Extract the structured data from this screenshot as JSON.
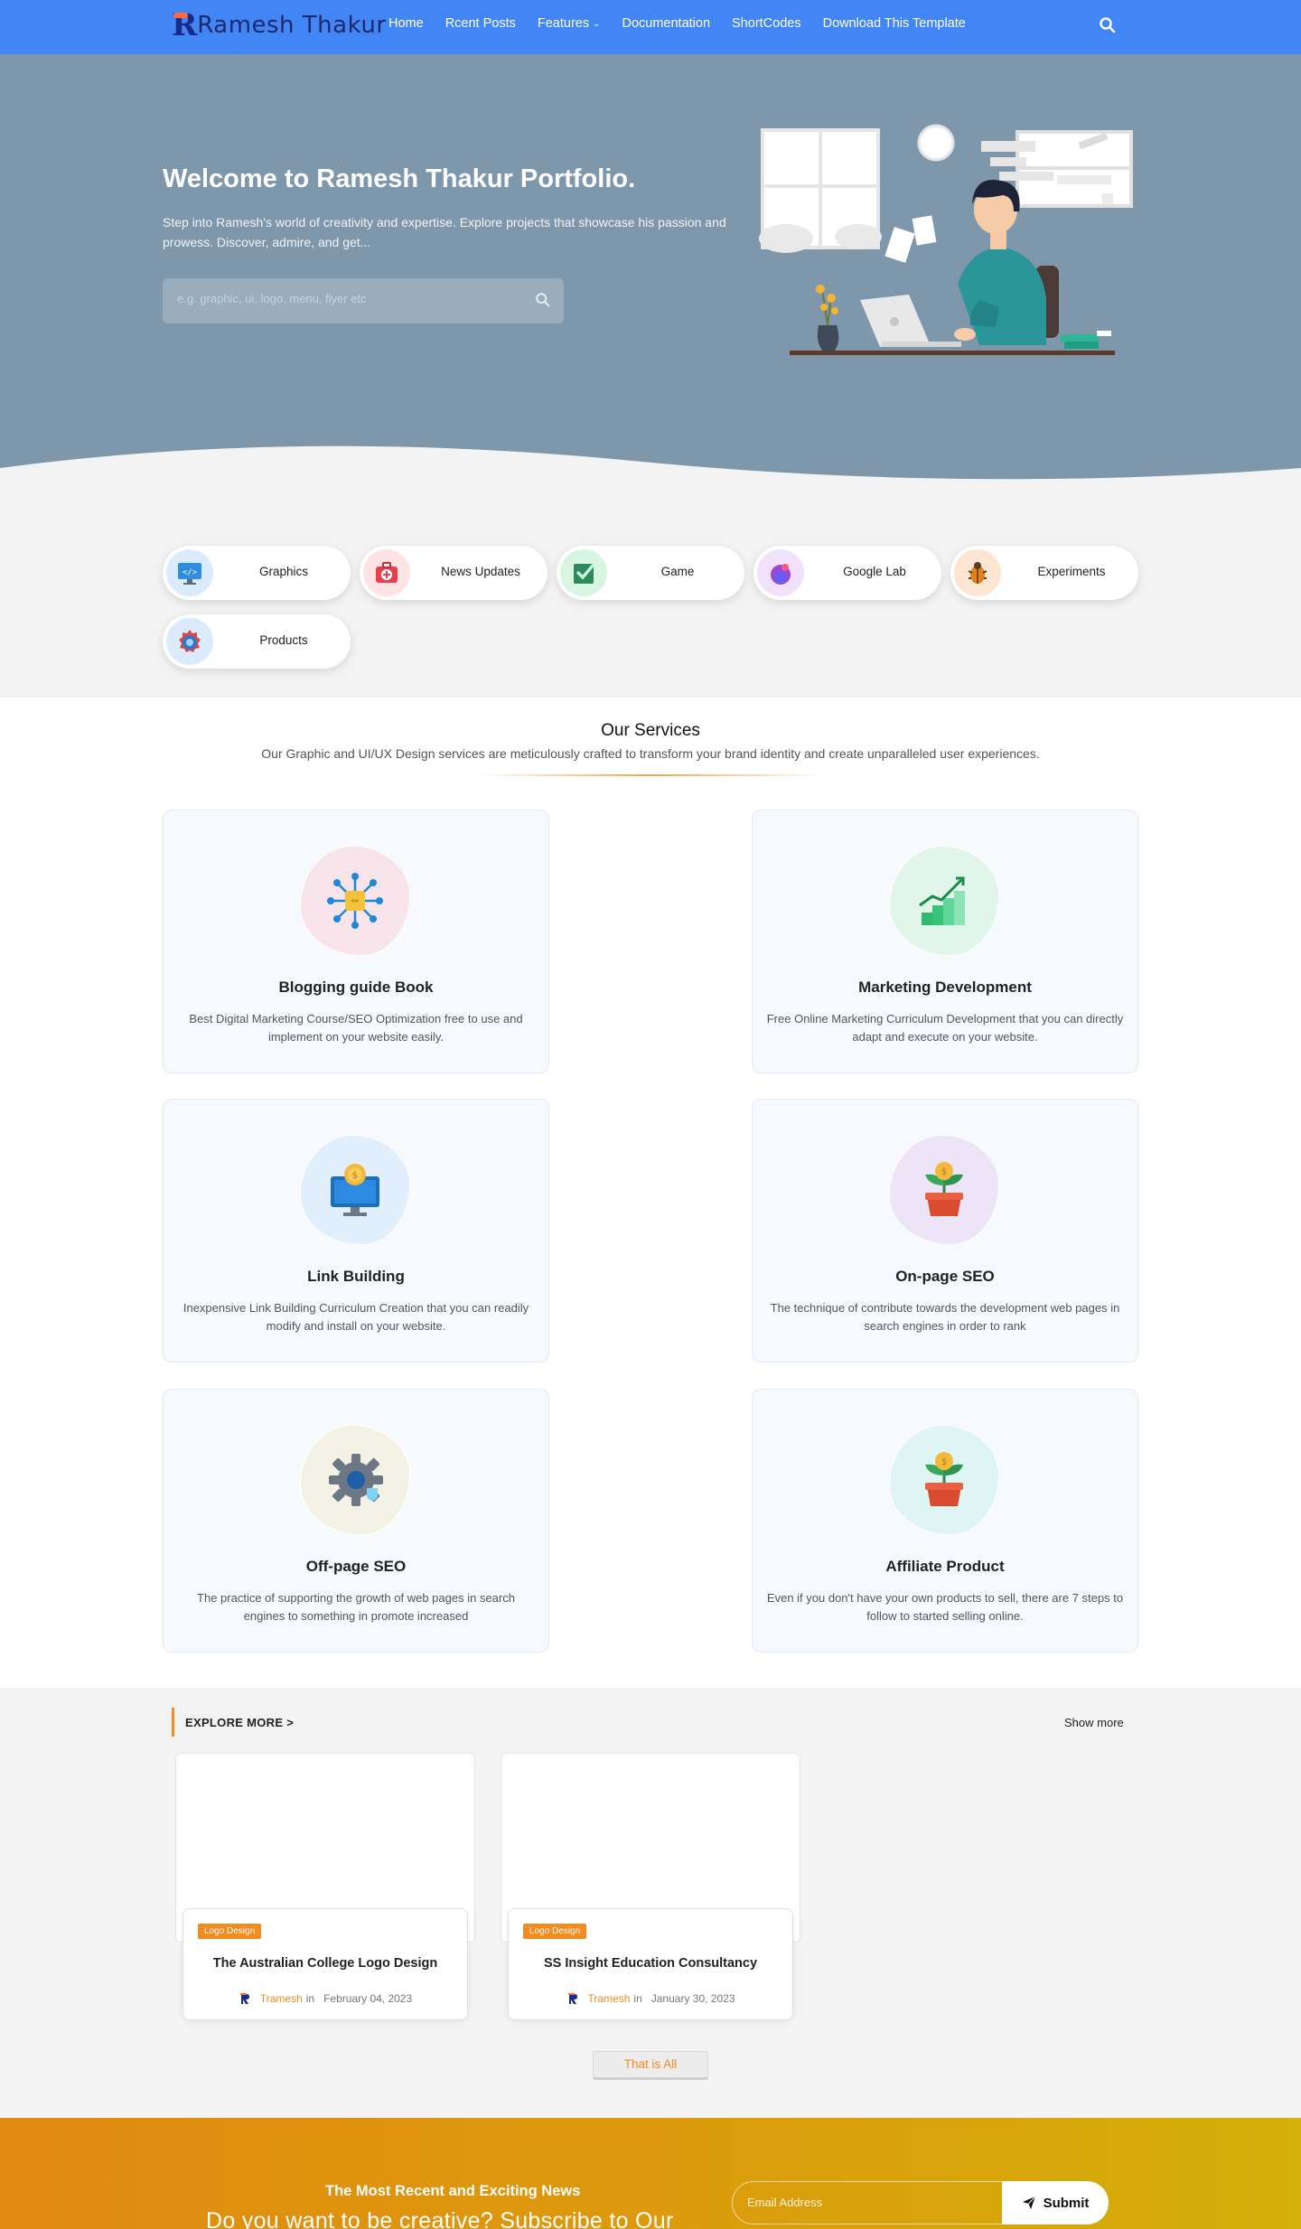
{
  "brand": {
    "logo_letter": "R",
    "name": "Ramesh Thakur"
  },
  "nav": {
    "items": [
      "Home",
      "Rcent Posts",
      "Features",
      "Documentation",
      "ShortCodes",
      "Download This Template"
    ],
    "features_has_dropdown": true,
    "search_icon": "search-icon"
  },
  "colors": {
    "nav": "#4285f4",
    "hero": "#7e97ab",
    "accent": "#f28c1e"
  },
  "hero": {
    "title": "Welcome to Ramesh Thakur Portfolio.",
    "description": "Step into Ramesh's world of creativity and expertise. Explore projects that showcase his passion and prowess. Discover, admire, and get...",
    "search_placeholder": "e.g. graphic, ui, logo, menu, flyer etc"
  },
  "categories": [
    {
      "label": "Graphics",
      "icon": "monitor-code-icon"
    },
    {
      "label": "News Updates",
      "icon": "first-aid-kit-icon"
    },
    {
      "label": "Game",
      "icon": "checkbox-icon"
    },
    {
      "label": "Google Lab",
      "icon": "flask-icon"
    },
    {
      "label": "Experiments",
      "icon": "bug-icon"
    },
    {
      "label": "Products",
      "icon": "badge-icon"
    }
  ],
  "services": {
    "title": "Our Services",
    "subtitle": "Our Graphic and UI/UX Design services are meticulously crafted to transform your brand identity and create unparalleled user experiences.",
    "items": [
      {
        "title": "Blogging guide Book",
        "desc": "Best Digital Marketing Course/SEO Optimization free to use and implement on your website easily.",
        "icon": "network-icon"
      },
      {
        "title": "Marketing Development",
        "desc": "Free Online Marketing Curriculum Development that you can directly adapt and execute on your website.",
        "icon": "growth-chart-icon"
      },
      {
        "title": "Link Building",
        "desc": "Inexpensive Link Building Curriculum Creation that you can readily modify and install on your website.",
        "icon": "monitor-coin-icon"
      },
      {
        "title": "On-page SEO",
        "desc": "The technique of contribute towards the development web pages in search engines in order to rank",
        "icon": "money-plant-icon"
      },
      {
        "title": "Off-page SEO",
        "desc": "The practice of supporting the growth of web pages in search engines to something in promote increased",
        "icon": "gear-icon"
      },
      {
        "title": "Affiliate Product",
        "desc": "Even if you don't have your own products to sell, there are 7 steps to follow to started selling online.",
        "icon": "money-plant-icon"
      }
    ]
  },
  "explore": {
    "title": "EXPLORE MORE >",
    "show_more": "Show more",
    "posts": [
      {
        "tag": "Logo Design",
        "title": "The Australian College Logo Design",
        "author": "Tramesh",
        "in": "in",
        "date": "February 04, 2023"
      },
      {
        "tag": "Logo Design",
        "title": "SS Insight Education Consultancy",
        "author": "Tramesh",
        "in": "in",
        "date": "January 30, 2023"
      }
    ],
    "end_button": "That is All"
  },
  "newsletter": {
    "kicker": "The Most Recent and Exciting News",
    "headline": "Do you want to be creative? Subscribe to Our",
    "email_placeholder": "Email Address",
    "submit_label": "Submit"
  }
}
